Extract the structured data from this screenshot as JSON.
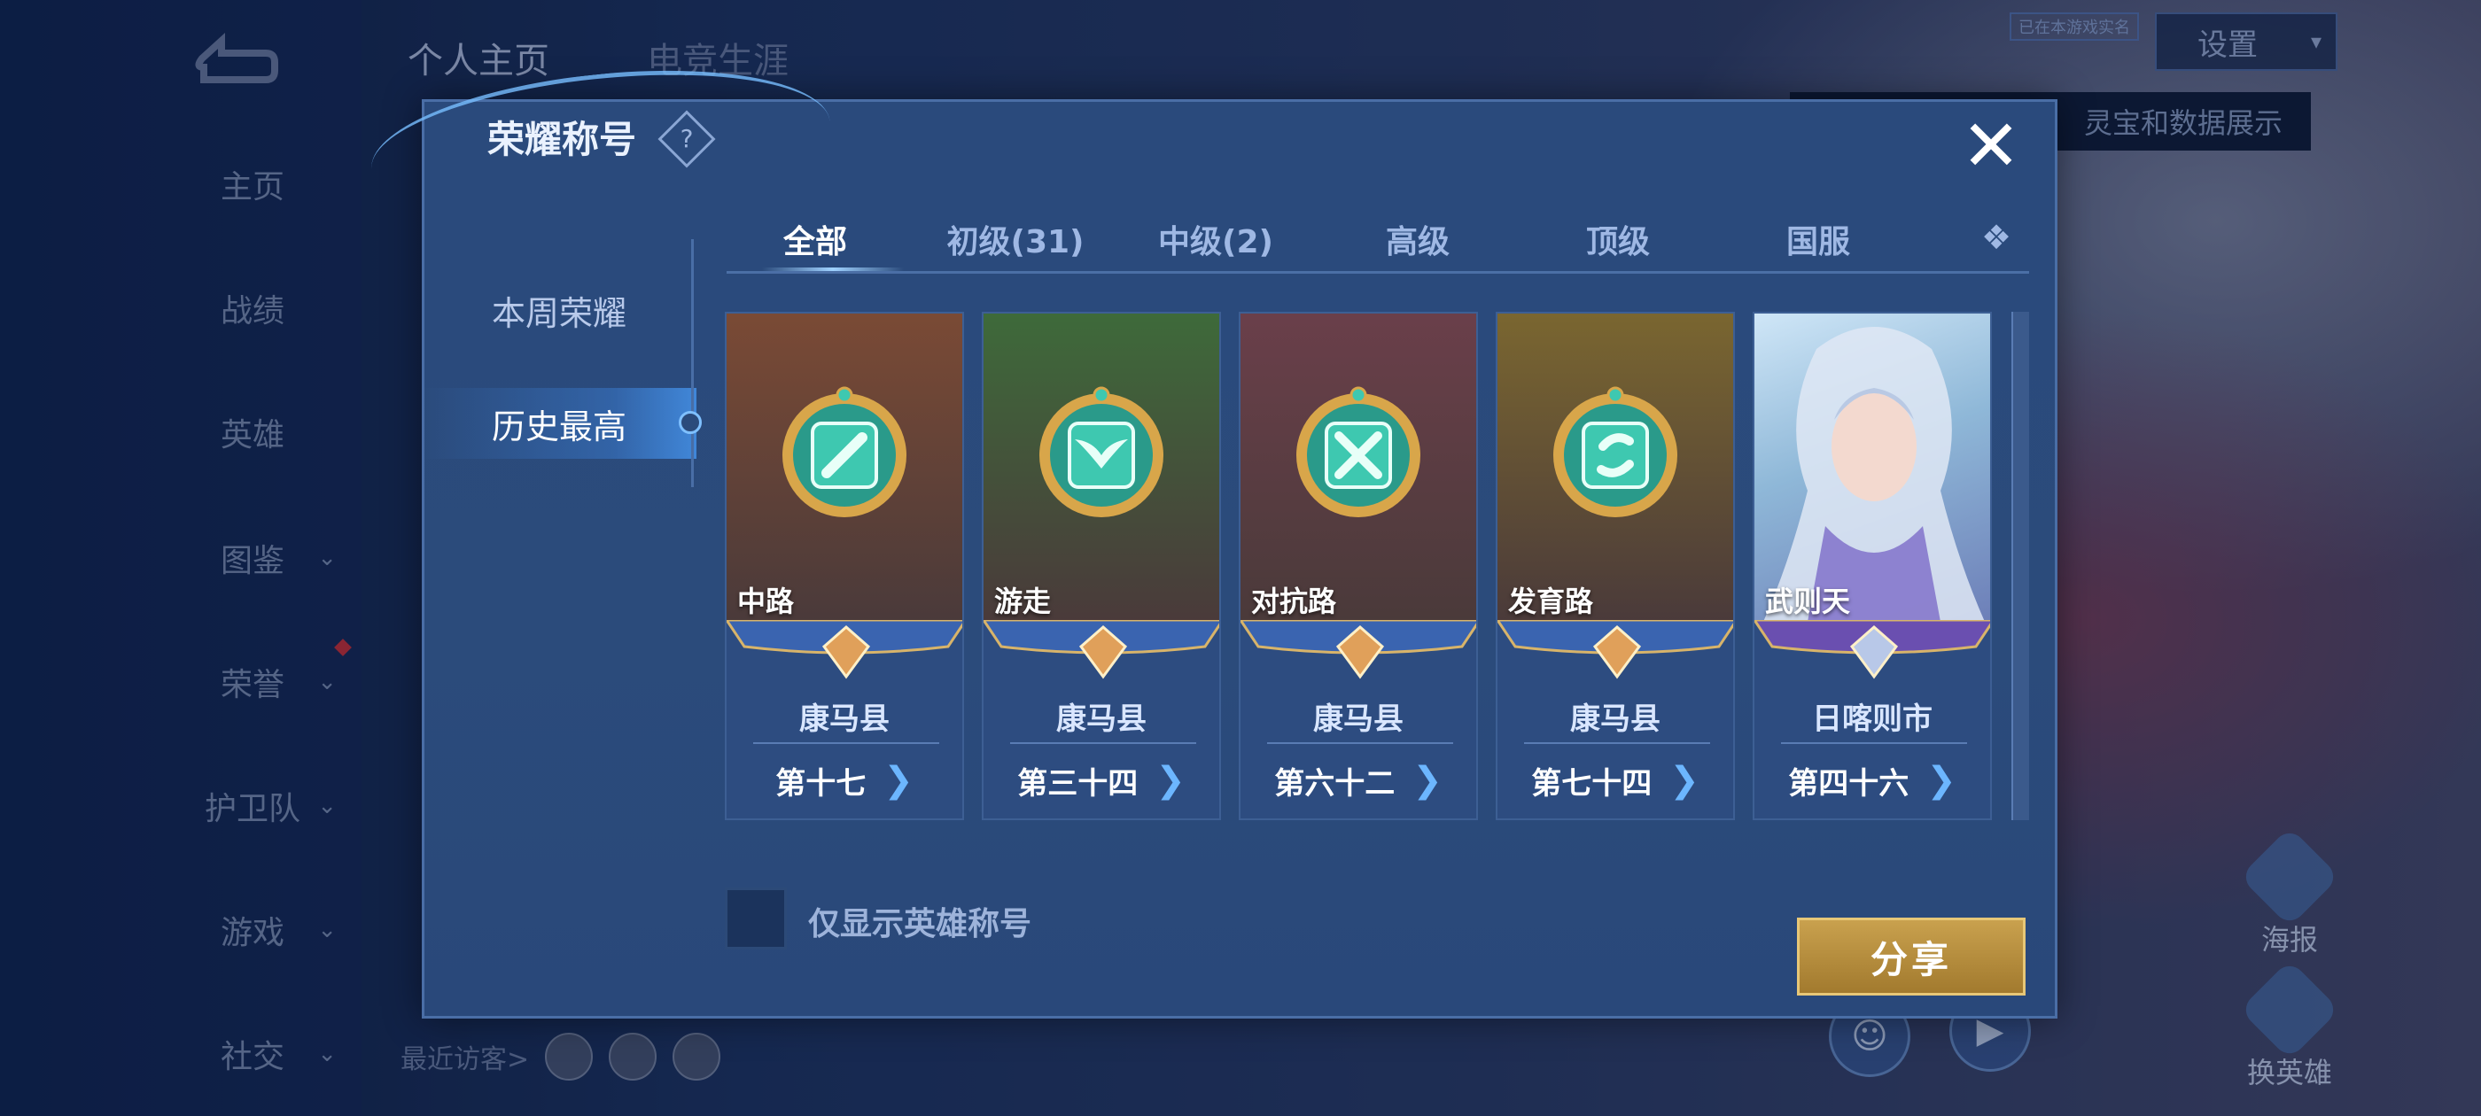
{
  "background": {
    "nav": {
      "items": [
        {
          "label": "主页",
          "active": true,
          "has_chevron": false
        },
        {
          "label": "战绩",
          "active": false,
          "has_chevron": false
        },
        {
          "label": "英雄",
          "active": false,
          "has_chevron": false
        },
        {
          "label": "图鉴",
          "active": false,
          "has_chevron": true
        },
        {
          "label": "荣誉",
          "active": false,
          "has_chevron": true
        },
        {
          "label": "护卫队",
          "active": false,
          "has_chevron": true
        },
        {
          "label": "游戏",
          "active": false,
          "has_chevron": true
        },
        {
          "label": "社交",
          "active": false,
          "has_chevron": true
        }
      ]
    },
    "top_tabs": [
      "个人主页",
      "电竞生涯"
    ],
    "auth_tag": "已在本游戏实名",
    "settings_label": "设置",
    "tooltip_text": "灵宝和数据展示",
    "recent_visitors_label": "最近访客>",
    "right_buttons": [
      "海报",
      "换英雄"
    ]
  },
  "modal": {
    "title": "荣耀称号",
    "help_icon_symbol": "?",
    "close_symbol": "✕",
    "left_menu": [
      {
        "label": "本周荣耀",
        "active": false
      },
      {
        "label": "历史最高",
        "active": true
      }
    ],
    "tabs": [
      {
        "label": "全部",
        "active": true
      },
      {
        "label": "初级(31)",
        "active": false
      },
      {
        "label": "中级(2)",
        "active": false
      },
      {
        "label": "高级",
        "active": false
      },
      {
        "label": "顶级",
        "active": false
      },
      {
        "label": "国服",
        "active": false
      }
    ],
    "tab_more": "❖",
    "cards": [
      {
        "name": "中路",
        "location": "康马县",
        "rank": "第十七",
        "badge_icon": "sword-icon",
        "tier": "bronze",
        "bg_color": "#7a4a35"
      },
      {
        "name": "游走",
        "location": "康马县",
        "rank": "第三十四",
        "badge_icon": "wings-icon",
        "tier": "bronze",
        "bg_color": "#3e6a3a"
      },
      {
        "name": "对抗路",
        "location": "康马县",
        "rank": "第六十二",
        "badge_icon": "crossed-swords-icon",
        "tier": "bronze",
        "bg_color": "#6a3f4a"
      },
      {
        "name": "发育路",
        "location": "康马县",
        "rank": "第七十四",
        "badge_icon": "arrow-ring-icon",
        "tier": "bronze",
        "bg_color": "#7a6630"
      },
      {
        "name": "武则天",
        "location": "日喀则市",
        "rank": "第四十六",
        "badge_icon": "hero-portrait",
        "tier": "silver",
        "bg_color": "#8fb8d8"
      }
    ],
    "rank_arrow": "❯",
    "checkbox_label": "仅显示英雄称号",
    "checkbox_checked": false,
    "share_label": "分享"
  },
  "colors": {
    "accent_blue": "#6cb6ff",
    "share_gold": "#c9a14e",
    "modal_bg": "#2a4a7c"
  }
}
